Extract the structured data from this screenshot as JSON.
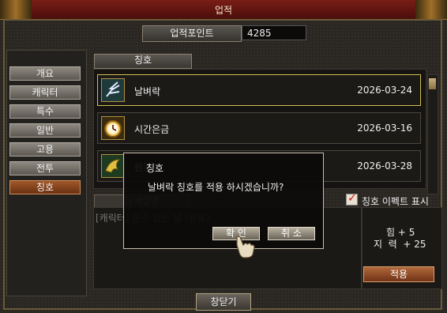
{
  "window": {
    "title": "업적"
  },
  "points": {
    "label": "업적포인트",
    "value": "4285"
  },
  "nav": [
    {
      "label": "개요",
      "active": false
    },
    {
      "label": "캐릭터",
      "active": false
    },
    {
      "label": "특수",
      "active": false
    },
    {
      "label": "일반",
      "active": false
    },
    {
      "label": "고용",
      "active": false
    },
    {
      "label": "전투",
      "active": false
    },
    {
      "label": "칭호",
      "active": true
    }
  ],
  "list": {
    "header": "칭호",
    "rows": [
      {
        "name": "날벼락",
        "date": "2026-03-24",
        "icon": "lightning-icon",
        "selected": true
      },
      {
        "name": "시간은금",
        "date": "2026-03-16",
        "icon": "clock-icon",
        "selected": false
      },
      {
        "name": "완강",
        "date": "2026-03-28",
        "icon": "dragon-icon",
        "selected": false
      }
    ]
  },
  "detail": {
    "header": "상세설명",
    "text": "[캐릭터] 운수 없는 날 (완료)"
  },
  "effect": {
    "label": "칭호 이펙트 표시",
    "checked": true
  },
  "stats": {
    "line1": "힘 + 5",
    "line2": "지  력  + 25"
  },
  "buttons": {
    "apply": "적용",
    "close": "창닫기"
  },
  "dialog": {
    "title": "칭호",
    "message": "날벼락 칭호를 적용 하시겠습니까?",
    "confirm": "확 인",
    "cancel": "취 소"
  },
  "colors": {
    "titlebar": "#7a1d17",
    "active_tab": "#a0582a",
    "selected_border": "#d0c050",
    "check": "#d01010"
  }
}
